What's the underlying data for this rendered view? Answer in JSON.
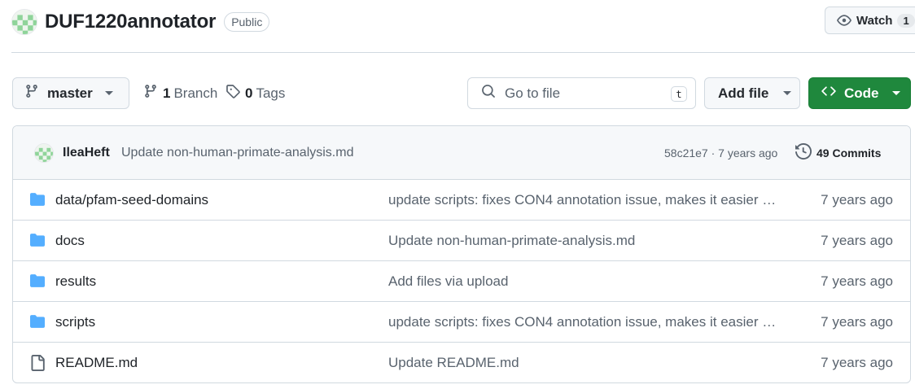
{
  "repo": {
    "name": "DUF1220annotator",
    "visibility": "Public",
    "watch_label": "Watch",
    "watch_count": "1"
  },
  "toolbar": {
    "branch": "master",
    "branches_count": "1",
    "branches_label": "Branch",
    "tags_count": "0",
    "tags_label": "Tags",
    "search_placeholder": "Go to file",
    "search_shortcut": "t",
    "add_file_label": "Add file",
    "code_label": "Code",
    "accent_color": "#1f883d"
  },
  "commit": {
    "author": "IleaHeft",
    "message": "Update non-human-primate-analysis.md",
    "sha_time": "58c21e7 · 7 years ago",
    "count_label": "49 Commits"
  },
  "files": [
    {
      "type": "folder",
      "icon": "folder-icon",
      "name": "data/pfam-seed-domains",
      "message": "update scripts: fixes CON4 annotation issue, makes it easier t…",
      "age": "7 years ago"
    },
    {
      "type": "folder",
      "icon": "folder-icon",
      "name": "docs",
      "message": "Update non-human-primate-analysis.md",
      "age": "7 years ago"
    },
    {
      "type": "folder",
      "icon": "folder-icon",
      "name": "results",
      "message": "Add files via upload",
      "age": "7 years ago"
    },
    {
      "type": "folder",
      "icon": "folder-icon",
      "name": "scripts",
      "message": "update scripts: fixes CON4 annotation issue, makes it easier t…",
      "age": "7 years ago"
    },
    {
      "type": "file",
      "icon": "file-icon",
      "name": "README.md",
      "message": "Update README.md",
      "age": "7 years ago"
    }
  ]
}
